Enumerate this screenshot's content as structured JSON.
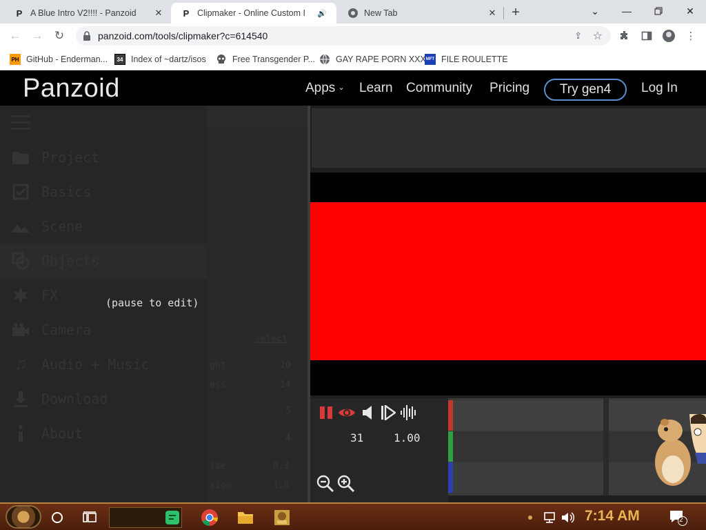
{
  "browser": {
    "tabs": [
      {
        "title": "A Blue Intro V2!!!! - Panzoid",
        "favicon": "P",
        "active": false
      },
      {
        "title": "Clipmaker - Online Custom I",
        "favicon": "P",
        "active": true,
        "audio": true
      },
      {
        "title": "New Tab",
        "favicon": "chrome-icon",
        "active": false
      }
    ],
    "url": "panzoid.com/tools/clipmaker?c=614540",
    "bookmarks": [
      {
        "label": "GitHub - Enderman...",
        "icon": "PH",
        "color": "#ff9900"
      },
      {
        "label": "Index of ~dartz/isos",
        "icon": "34",
        "color": "#3c3c3c"
      },
      {
        "label": "Free Transgender P...",
        "icon": "skull-icon",
        "color": "#555555"
      },
      {
        "label": "GAY RAPE PORN XXX",
        "icon": "globe-icon",
        "color": "#5f6368"
      },
      {
        "label": "FILE ROULETTE",
        "icon": "MFT",
        "color": "#1c3fb8"
      }
    ]
  },
  "site": {
    "logo": "Panzoid",
    "nav": [
      "Apps",
      "Learn",
      "Community",
      "Pricing"
    ],
    "cta": "Try gen4",
    "login": "Log In",
    "accent": "#5a8fd0"
  },
  "editor": {
    "menu": [
      {
        "label": "Project",
        "icon": "folder-icon"
      },
      {
        "label": "Basics",
        "icon": "checkbox-icon"
      },
      {
        "label": "Scene",
        "icon": "landscape-icon"
      },
      {
        "label": "Objects",
        "icon": "objects-icon"
      },
      {
        "label": "FX",
        "icon": "sparkle-icon"
      },
      {
        "label": "Camera",
        "icon": "camera-icon"
      },
      {
        "label": "Audio + Music",
        "icon": "music-note-icon"
      },
      {
        "label": "Download",
        "icon": "download-icon"
      },
      {
        "label": "About",
        "icon": "info-icon"
      }
    ],
    "selected_menu": "Objects",
    "pause_hint": "(pause to edit)",
    "ghost_text": {
      "select": "select",
      "r1_label": "ght",
      "r1_value": "20",
      "r2_label": "ess",
      "r2_value": "14",
      "r3_value": "5",
      "r4_value": "4",
      "r5_label": "ize",
      "r5_value": "0.3",
      "r6_label": "sion",
      "r6_value": "1.0"
    },
    "preview_color": "#ff0000",
    "readout_frame": "31",
    "readout_speed": "1.00",
    "track_colors": [
      "#c0392b",
      "#2ea043",
      "#2f3fb0"
    ]
  },
  "taskbar": {
    "clock": "7:14 AM",
    "notification_count": "2"
  }
}
